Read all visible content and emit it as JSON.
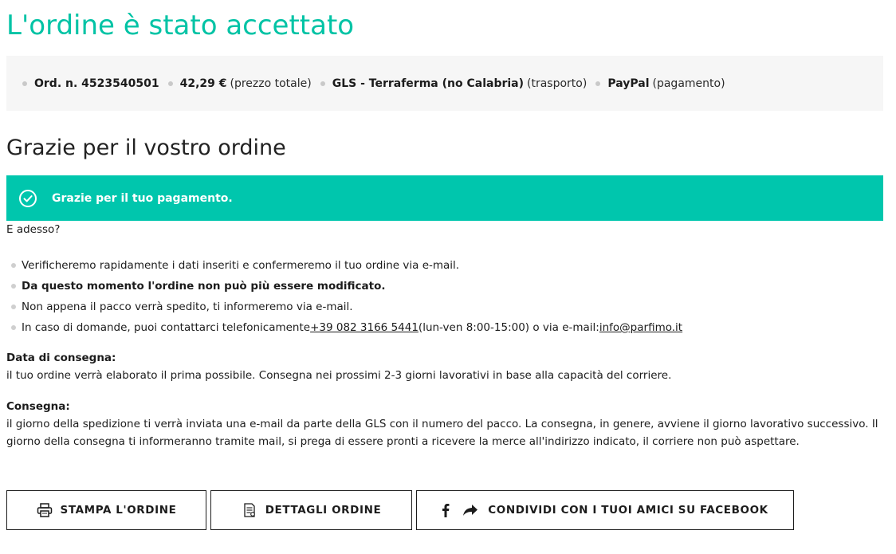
{
  "page_title": "L'ordine è stato accettato",
  "summary": {
    "order": "Ord. n. 4523540501",
    "price_value": "42,29 €",
    "price_note": "(prezzo totale)",
    "shipping_value": "GLS - Terraferma (no Calabria)",
    "shipping_note": "(trasporto)",
    "payment_value": "PayPal",
    "payment_note": "(pagamento)"
  },
  "thanks_heading": "Grazie per il vostro ordine",
  "banner": {
    "icon": "check-circle-icon",
    "message": "Grazie per il tuo pagamento.",
    "color": "#00c6ad"
  },
  "next_label": "E adesso?",
  "steps": [
    {
      "text": "Verificheremo rapidamente i dati inseriti e confermeremo il tuo ordine via e-mail."
    },
    {
      "text": "Da questo momento l'ordine non può più essere modificato."
    },
    {
      "text": "Non appena il pacco verrà spedito, ti informeremo via e-mail."
    },
    {
      "text_before": "In caso di domande, puoi contattarci telefonicamente ",
      "phone": "+39 082 3166 5441",
      "text_middle": " (lun-ven 8:00-15:00) o via e-mail: ",
      "email": "info@parfimo.it"
    }
  ],
  "delivery_date": {
    "label": "Data di consegna:",
    "text": "il tuo ordine verrà elaborato il prima possibile. Consegna nei prossimi 2-3 giorni lavorativi in base alla capacità del corriere."
  },
  "delivery": {
    "label": "Consegna:",
    "text": "il giorno della spedizione ti verrà inviata una e-mail da parte della GLS con il numero del pacco. La consegna, in genere, avviene il giorno lavorativo successivo. Il giorno della consegna ti informeranno tramite mail, si prega di essere pronti a ricevere la merce all'indirizzo indicato, il corriere non può aspettare."
  },
  "buttons": {
    "print": {
      "label": "STAMPA L'ORDINE",
      "icon": "printer-icon"
    },
    "details": {
      "label": "DETTAGLI ORDINE",
      "icon": "receipt-icon"
    },
    "share": {
      "label": "CONDIVIDI CON I TUOI AMICI SU FACEBOOK",
      "icon": "facebook-icon",
      "icon2": "share-arrow-icon"
    }
  },
  "colors": {
    "accent": "#00c3a5",
    "summary_bg": "#f6f6f6"
  }
}
